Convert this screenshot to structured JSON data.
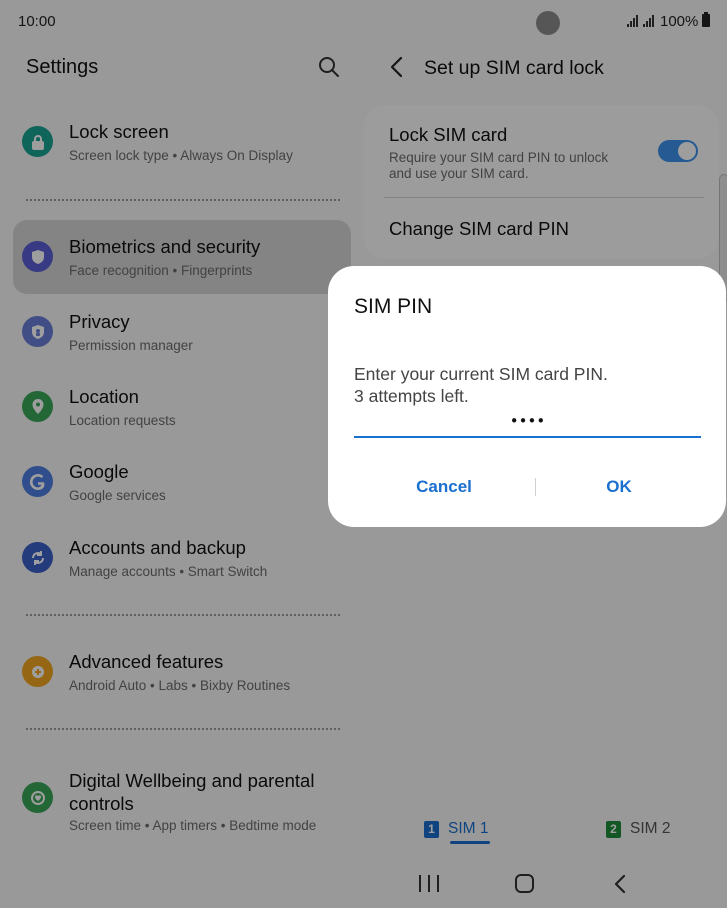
{
  "status_bar": {
    "time": "10:00",
    "battery": "100%"
  },
  "settings": {
    "title": "Settings",
    "items": [
      {
        "title": "Lock screen",
        "subtitle": "Screen lock type  •  Always On Display",
        "icon": "lock-icon",
        "color": "#1aa394"
      },
      {
        "title": "Biometrics and security",
        "subtitle": "Face recognition  •  Fingerprints",
        "icon": "shield-icon",
        "color": "#5b5fd6"
      },
      {
        "title": "Privacy",
        "subtitle": "Permission manager",
        "icon": "privacy-shield-icon",
        "color": "#6a7ed8"
      },
      {
        "title": "Location",
        "subtitle": "Location requests",
        "icon": "location-pin-icon",
        "color": "#3aa657"
      },
      {
        "title": "Google",
        "subtitle": "Google services",
        "icon": "google-g-icon",
        "color": "#4e7fe0"
      },
      {
        "title": "Accounts and backup",
        "subtitle": "Manage accounts  •  Smart Switch",
        "icon": "sync-icon",
        "color": "#3b5fc9"
      },
      {
        "title": "Advanced features",
        "subtitle": "Android Auto  •  Labs  •  Bixby Routines",
        "icon": "gear-plus-icon",
        "color": "#f0a623"
      },
      {
        "title": "Digital Wellbeing and parental controls",
        "subtitle": "Screen time  •  App timers  •  Bedtime mode",
        "icon": "wellbeing-icon",
        "color": "#3aa657"
      }
    ]
  },
  "sim_lock": {
    "title": "Set up SIM card lock",
    "lock_title": "Lock SIM card",
    "lock_desc": "Require your SIM card PIN to unlock and use your SIM card.",
    "lock_enabled": true,
    "change_pin": "Change SIM card PIN",
    "tabs": [
      {
        "label": "SIM 1",
        "badge": "1"
      },
      {
        "label": "SIM 2",
        "badge": "2"
      }
    ]
  },
  "dialog": {
    "title": "SIM PIN",
    "message": "Enter your current SIM card PIN.\n3 attempts left.",
    "pin_value": "••••",
    "cancel_label": "Cancel",
    "ok_label": "OK"
  },
  "colors": {
    "accent": "#1a6fcf",
    "toggle": "#3e91ec"
  }
}
